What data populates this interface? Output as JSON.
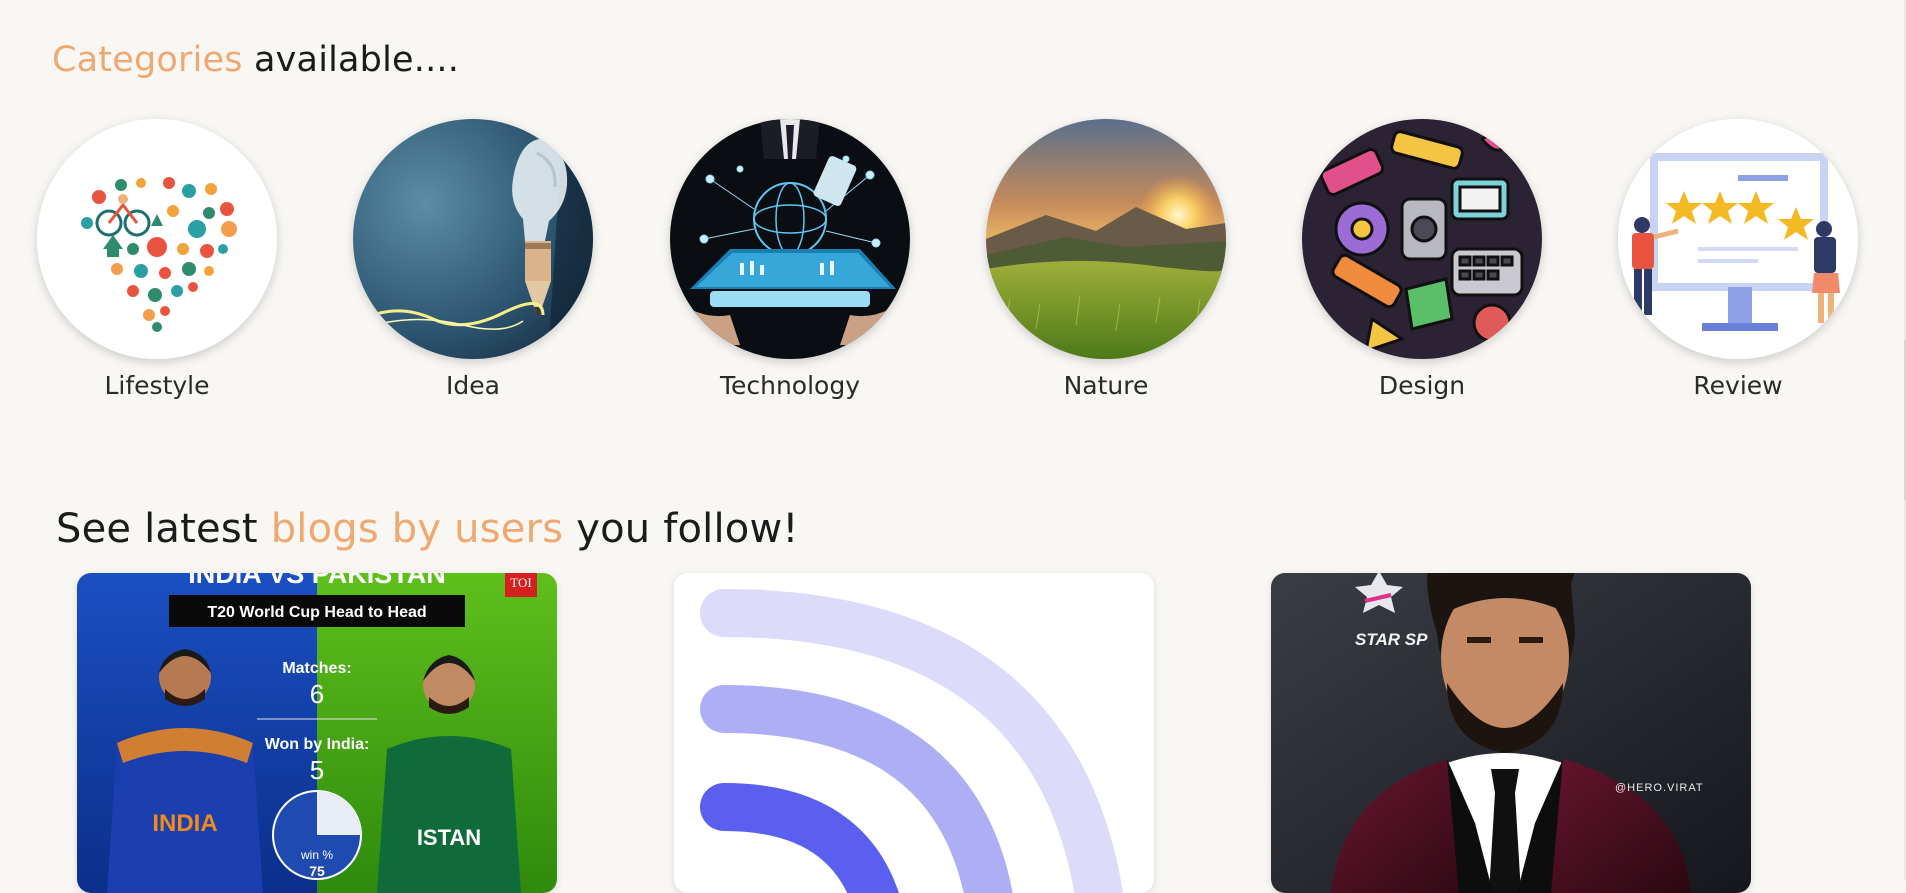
{
  "categories_heading": {
    "accent": "Categories",
    "rest": " available...."
  },
  "categories": [
    {
      "label": "Lifestyle",
      "icon": "lifestyle-heart-illustration"
    },
    {
      "label": "Idea",
      "icon": "lightbulb-pencil-image"
    },
    {
      "label": "Technology",
      "icon": "tablet-network-image"
    },
    {
      "label": "Nature",
      "icon": "mountain-sunset-image"
    },
    {
      "label": "Design",
      "icon": "doodle-art-image"
    },
    {
      "label": "Review",
      "icon": "star-rating-illustration"
    }
  ],
  "latest_heading": {
    "before": "See latest ",
    "accent": "blogs by users",
    "after": " you follow!"
  },
  "blogs": [
    {
      "image": "india-vs-pakistan-infographic",
      "title": "INDIA VS PAKISTAN",
      "badge": "TOI",
      "subtitle": "T20 World Cup Head to Head",
      "matches_label": "Matches:",
      "matches_value": "6",
      "won_label": "Won by India:",
      "won_value": "5",
      "win_label": "win %",
      "win_value": "75",
      "win_fraction": 0.75,
      "left_jersey": "INDIA",
      "right_jersey": "ISTAN"
    },
    {
      "image": "rss-feed-placeholder"
    },
    {
      "image": "virat-kohli-portrait",
      "watermark": "@HERO.VIRAT",
      "logo_text": "STAR SP"
    }
  ],
  "colors": {
    "accent": "#f0a871",
    "background": "#f9f7f4"
  }
}
